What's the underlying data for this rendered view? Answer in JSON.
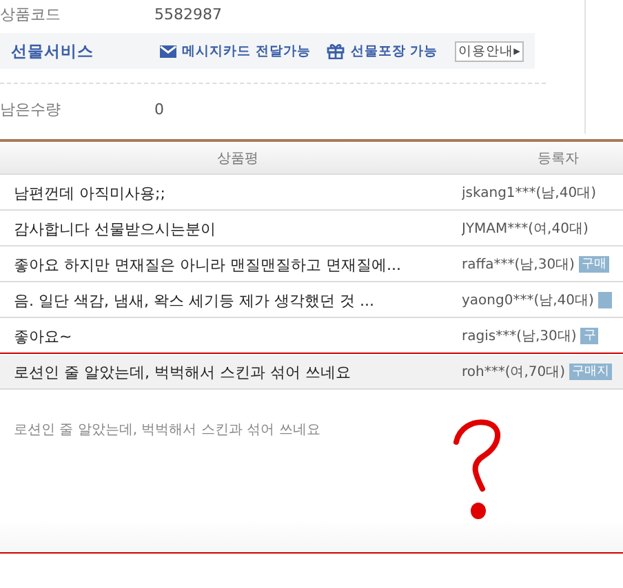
{
  "product_info": [
    {
      "label": "상품코드",
      "value": "5582987"
    }
  ],
  "gift_service": {
    "title": "선물서비스",
    "features": [
      {
        "kind": "card",
        "label": "메시지카드 전달가능"
      },
      {
        "kind": "wrap",
        "label": "선물포장 가능"
      }
    ],
    "guide_button": "이용안내▸"
  },
  "stock": {
    "label": "남은수량",
    "value": "0"
  },
  "reviews": {
    "columns": [
      "상품평",
      "등록자"
    ],
    "rows": [
      {
        "text": "남편껀데 아직미사용;;",
        "author": "jskang1***(남,40대)",
        "buyer": false,
        "selected": false
      },
      {
        "text": "감사합니다 선물받으시는분이",
        "author": "JYMAM***(여,40대)",
        "buyer": false,
        "selected": false
      },
      {
        "text": "좋아요 하지만 면재질은 아니라 맨질맨질하고 면재질에...",
        "author": "raffa***(남,30대)",
        "buyer": true,
        "badge": "구매",
        "selected": false
      },
      {
        "text": "음. 일단 색감, 냄새, 왁스 세기등 제가 생각했던 것 ...",
        "author": "yaong0***(남,40대)",
        "buyer": true,
        "selected": false
      },
      {
        "text": "좋아요~",
        "author": "ragis***(남,30대)",
        "buyer": true,
        "badge": "구",
        "selected": false
      },
      {
        "text": "로션인 줄 알았는데, 벅벅해서 스킨과 섞어 쓰네요",
        "author": "roh***(여,70대)",
        "buyer": true,
        "badge": "구매지",
        "selected": true
      }
    ],
    "detail": "로션인 줄 알았는데, 벅벅해서 스킨과 섞어 쓰네요"
  }
}
